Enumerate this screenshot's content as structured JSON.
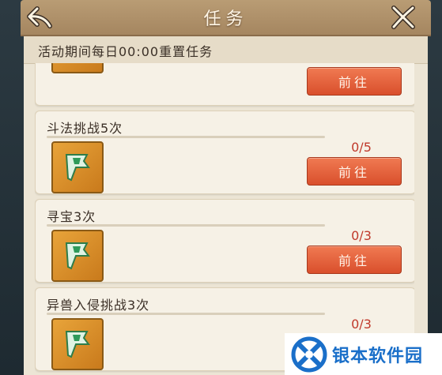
{
  "header": {
    "title": "任务",
    "back_icon": "back-arrow-icon",
    "close_icon": "close-icon"
  },
  "subtitle": "活动期间每日00:00重置任务",
  "tasks": [
    {
      "title": "",
      "counter": "",
      "progress": 0,
      "button": "前往",
      "icon": "flag-item-icon"
    },
    {
      "title": "斗法挑战5次",
      "counter": "0/5",
      "progress": 0,
      "button": "前往",
      "icon": "flag-item-icon"
    },
    {
      "title": "寻宝3次",
      "counter": "0/3",
      "progress": 0,
      "button": "前往",
      "icon": "flag-item-icon"
    },
    {
      "title": "异兽入侵挑战3次",
      "counter": "0/3",
      "progress": 0,
      "button": "",
      "icon": "flag-item-icon"
    }
  ],
  "watermark": {
    "text": "银本软件园",
    "icon": "logo-icon"
  },
  "colors": {
    "button": "#e0603a",
    "counter": "#c0392b",
    "panel": "#ece5d5"
  }
}
